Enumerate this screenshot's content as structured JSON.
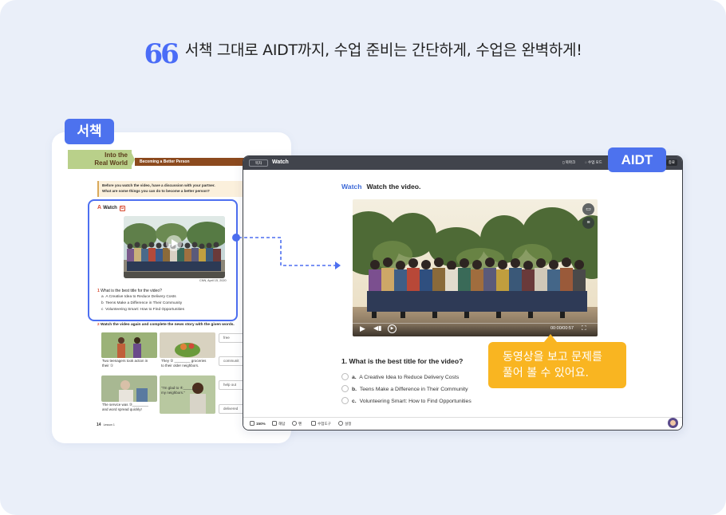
{
  "headline": {
    "quote_mark": "66",
    "text": "서책 그대로 AIDT까지, 수업 준비는 간단하게, 수업은 완벽하게!"
  },
  "book": {
    "tag": "서책",
    "into_line1": "Into the",
    "into_line2": "Real World",
    "section_title": "Becoming a Better Person",
    "pre_line1": "Before you watch the video, have a discussion with your partner.",
    "pre_line2": "What are some things you can do to become a better person?",
    "watch_letter": "A",
    "watch_label": "Watch",
    "watch_badge": "G",
    "video_credit": "CNN, April 15, 2020",
    "q1_num": "1",
    "q1_text": "What is the best title for the video?",
    "options": [
      {
        "letter": "a",
        "text": "A Creative Idea to Reduce Delivery Costs"
      },
      {
        "letter": "b",
        "text": "Teens Make a Difference in Their Community"
      },
      {
        "letter": "c",
        "text": "Volunteering Smart: How to Find Opportunities"
      }
    ],
    "q2_num": "2",
    "q2_text": "Watch the video again and complete the news story with the given words.",
    "captions": [
      {
        "line1": "Two teenagers took action in",
        "line2": "their ①"
      },
      {
        "line1": "They ② ________ groceries",
        "line2": "to their older neighbors."
      },
      {
        "line1": "The service was ③________",
        "line2": "and word spread quickly!"
      },
      {
        "line1": "\"I'm glad to ④________",
        "line2": "my neighbors.\""
      }
    ],
    "word_boxes": [
      "free",
      "communit",
      "help out",
      "delivered"
    ],
    "page_number": "14",
    "page_lesson": "Lesson 1"
  },
  "aidt": {
    "tag": "AIDT",
    "topbar": {
      "contents_btn": "목차",
      "title": "Watch",
      "bookmark": "북마크",
      "class_mode": "수업 모드",
      "end_btn": "종료"
    },
    "watch_label": "Watch",
    "watch_instruction": "Watch the video.",
    "video_time": "00:00/00:57",
    "question": "1. What is the best title for the video?",
    "options": [
      {
        "letter": "a.",
        "text": "A Creative Idea to Reduce Delivery Costs"
      },
      {
        "letter": "b.",
        "text": "Teens Make a Difference in Their Community"
      },
      {
        "letter": "c.",
        "text": "Volunteering Smart: How to Find Opportunities"
      }
    ],
    "bottom_bar": {
      "zoom": "150%",
      "answer": "해답",
      "pen": "펜",
      "tools": "수업도구",
      "settings": "설정"
    },
    "tooltip_line1": "동영상을 보고 문제를",
    "tooltip_line2": "풀어 볼 수 있어요."
  },
  "colors": {
    "accent_blue": "#4d72ee",
    "tooltip_yellow": "#f9b521",
    "background": "#eaeff9",
    "dark_bar": "#41444c"
  }
}
